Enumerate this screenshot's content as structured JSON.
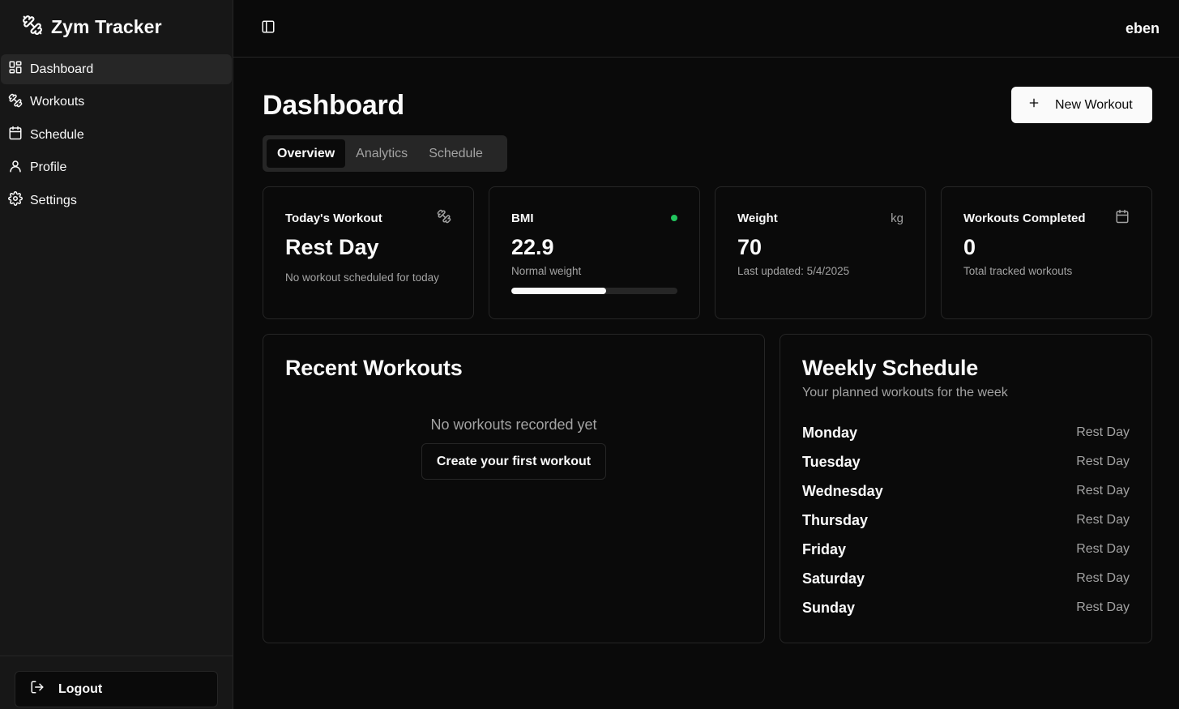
{
  "brand": {
    "name": "Zym Tracker",
    "icon": "dumbbell-icon"
  },
  "sidebar": {
    "items": [
      {
        "label": "Dashboard",
        "icon": "layout-grid-icon",
        "active": true
      },
      {
        "label": "Workouts",
        "icon": "dumbbell-icon",
        "active": false
      },
      {
        "label": "Schedule",
        "icon": "calendar-icon",
        "active": false
      },
      {
        "label": "Profile",
        "icon": "user-icon",
        "active": false
      },
      {
        "label": "Settings",
        "icon": "gear-icon",
        "active": false
      }
    ],
    "logout_label": "Logout"
  },
  "header": {
    "user": "eben",
    "toggle_icon": "panel-left-icon"
  },
  "page": {
    "title": "Dashboard",
    "new_workout_label": "New Workout",
    "tabs": [
      {
        "label": "Overview",
        "active": true
      },
      {
        "label": "Analytics",
        "active": false
      },
      {
        "label": "Schedule",
        "active": false
      }
    ]
  },
  "stats": {
    "today": {
      "label": "Today's Workout",
      "value": "Rest Day",
      "sub": "No workout scheduled for today"
    },
    "bmi": {
      "label": "BMI",
      "value": "22.9",
      "sub": "Normal weight",
      "progress": 0.57,
      "status_color": "#22c55e"
    },
    "weight": {
      "label": "Weight",
      "unit": "kg",
      "value": "70",
      "sub": "Last updated: 5/4/2025"
    },
    "completed": {
      "label": "Workouts Completed",
      "value": "0",
      "sub": "Total tracked workouts"
    }
  },
  "recent": {
    "title": "Recent Workouts",
    "empty_text": "No workouts recorded yet",
    "create_label": "Create your first workout"
  },
  "weekly": {
    "title": "Weekly Schedule",
    "subtitle": "Your planned workouts for the week",
    "days": [
      {
        "day": "Monday",
        "plan": "Rest Day"
      },
      {
        "day": "Tuesday",
        "plan": "Rest Day"
      },
      {
        "day": "Wednesday",
        "plan": "Rest Day"
      },
      {
        "day": "Thursday",
        "plan": "Rest Day"
      },
      {
        "day": "Friday",
        "plan": "Rest Day"
      },
      {
        "day": "Saturday",
        "plan": "Rest Day"
      },
      {
        "day": "Sunday",
        "plan": "Rest Day"
      }
    ]
  },
  "colors": {
    "background": "#0a0a0a",
    "sidebar": "#171717",
    "border": "#262626",
    "muted": "#a3a3a3",
    "accent": "#fafafa"
  }
}
